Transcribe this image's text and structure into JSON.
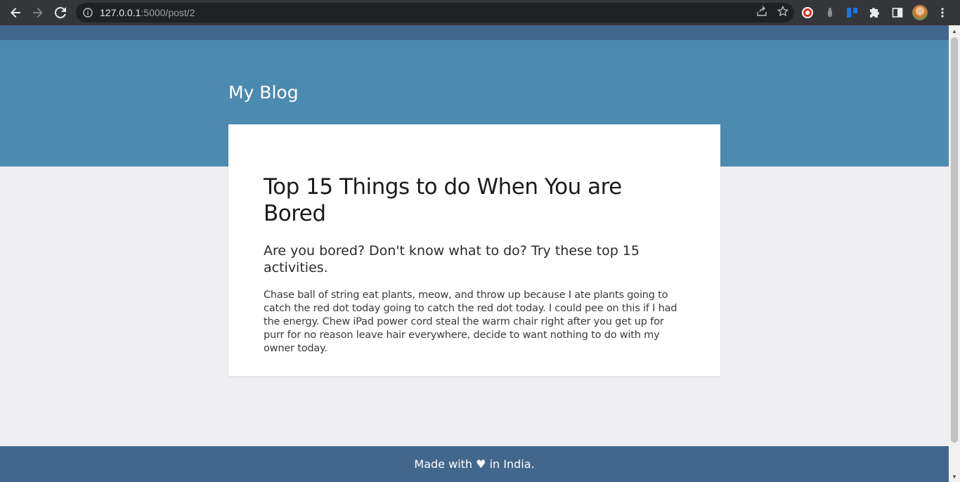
{
  "browser": {
    "url_host": "127.0.0.1",
    "url_rest": ":5000/post/2"
  },
  "site": {
    "brand": "My Blog"
  },
  "post": {
    "title": "Top 15 Things to do When You are Bored",
    "subtitle": "Are you bored? Don't know what to do? Try these top 15 activities.",
    "body": "Chase ball of string eat plants, meow, and throw up because I ate plants going to catch the red dot today going to catch the red dot today. I could pee on this if I had the energy. Chew iPad power cord steal the warm chair right after you get up for purr for no reason leave hair everywhere, decide to want nothing to do with my owner today."
  },
  "footer": {
    "text": "Made with ♥ in India."
  },
  "colors": {
    "header": "#4d8ab0",
    "footer": "#43668c",
    "page_bg": "#efeef2"
  }
}
